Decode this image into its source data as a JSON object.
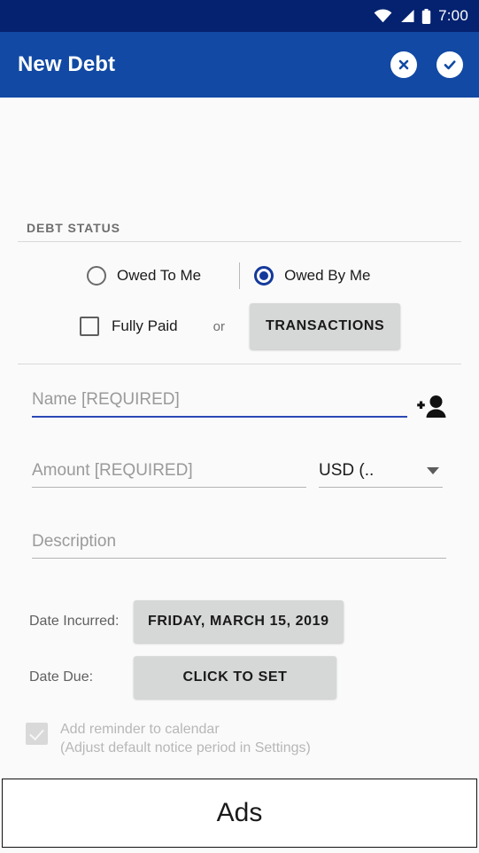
{
  "status_bar": {
    "time": "7:00",
    "icons": [
      "wifi-icon",
      "cell-signal-icon",
      "battery-icon"
    ]
  },
  "app_bar": {
    "title": "New Debt",
    "cancel_icon": "close-circle-icon",
    "confirm_icon": "check-circle-icon",
    "background_color": "#1149a4"
  },
  "debt_status": {
    "section_label": "DEBT STATUS",
    "radios": [
      {
        "label": "Owed To Me",
        "selected": false
      },
      {
        "label": "Owed By Me",
        "selected": true
      }
    ],
    "fully_paid": {
      "label": "Fully Paid",
      "checked": false
    },
    "or_text": "or",
    "transactions_button": "TRANSACTIONS"
  },
  "form": {
    "name": {
      "placeholder": "Name [REQUIRED]",
      "value": "",
      "focused": true
    },
    "add_contact_icon": "person-add-icon",
    "amount": {
      "placeholder": "Amount [REQUIRED]",
      "value": ""
    },
    "currency": {
      "value": "USD (..",
      "caret_icon": "caret-down-icon"
    },
    "description": {
      "placeholder": "Description",
      "value": ""
    }
  },
  "dates": {
    "incurred_label": "Date Incurred:",
    "incurred_value": "FRIDAY, MARCH 15, 2019",
    "due_label": "Date Due:",
    "due_value": "CLICK TO SET"
  },
  "reminder": {
    "checked": true,
    "enabled": false,
    "line1": "Add reminder to calendar",
    "line2": "(Adjust default notice period in Settings)"
  },
  "ads": {
    "label": "Ads"
  },
  "colors": {
    "status_bar": "#042270",
    "app_bar": "#1149a4",
    "accent": "#2b49b5",
    "radio_selected": "#13399b",
    "button_grey": "#d6d7d7",
    "page_background": "#fafafa"
  }
}
